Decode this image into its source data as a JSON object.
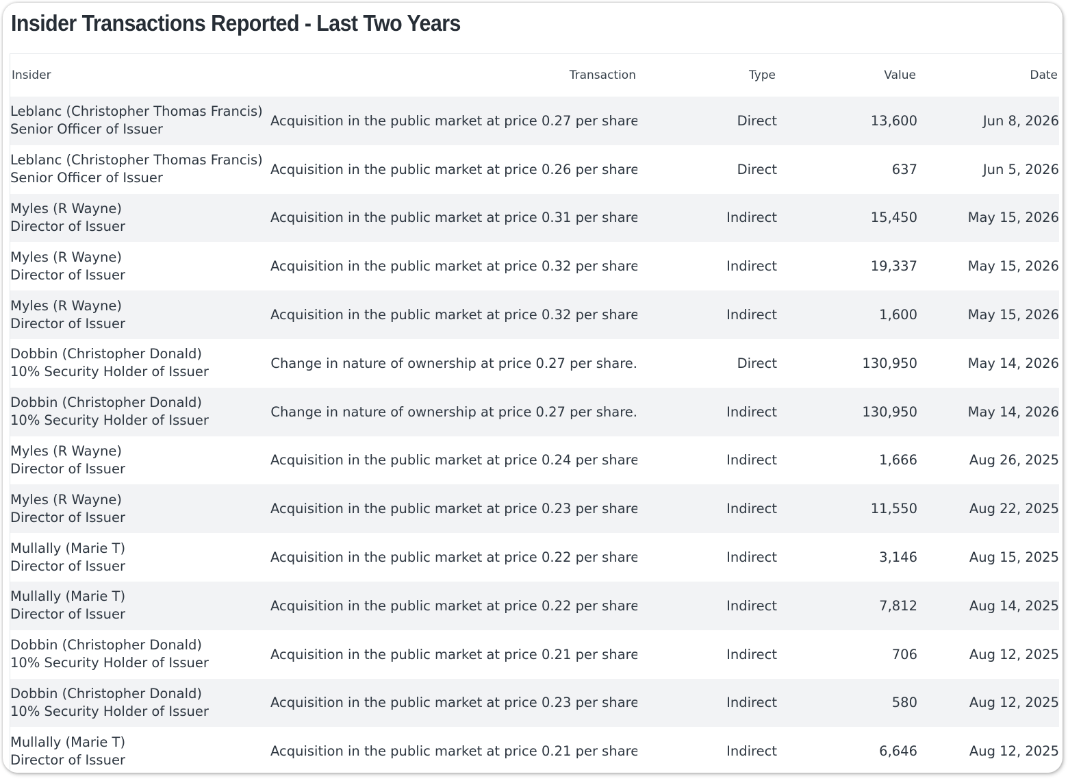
{
  "title": "Insider Transactions Reported - Last Two Years",
  "columns": {
    "insider": "Insider",
    "transaction": "Transaction",
    "type": "Type",
    "value": "Value",
    "date": "Date"
  },
  "rows": [
    {
      "name": "Leblanc (Christopher Thomas Francis)",
      "role": "Senior Officer of Issuer",
      "transaction": "Acquisition in the public market at price 0.27 per share.",
      "type": "Direct",
      "value": "13,600",
      "date": "Jun 8, 2026"
    },
    {
      "name": "Leblanc (Christopher Thomas Francis)",
      "role": "Senior Officer of Issuer",
      "transaction": "Acquisition in the public market at price 0.26 per share.",
      "type": "Direct",
      "value": "637",
      "date": "Jun 5, 2026"
    },
    {
      "name": "Myles (R Wayne)",
      "role": "Director of Issuer",
      "transaction": "Acquisition in the public market at price 0.31 per share.",
      "type": "Indirect",
      "value": "15,450",
      "date": "May 15, 2026"
    },
    {
      "name": "Myles (R Wayne)",
      "role": "Director of Issuer",
      "transaction": "Acquisition in the public market at price 0.32 per share.",
      "type": "Indirect",
      "value": "19,337",
      "date": "May 15, 2026"
    },
    {
      "name": "Myles (R Wayne)",
      "role": "Director of Issuer",
      "transaction": "Acquisition in the public market at price 0.32 per share.",
      "type": "Indirect",
      "value": "1,600",
      "date": "May 15, 2026"
    },
    {
      "name": "Dobbin (Christopher Donald)",
      "role": "10% Security Holder of Issuer",
      "transaction": "Change in nature of ownership at price 0.27 per share.",
      "type": "Direct",
      "value": "130,950",
      "date": "May 14, 2026"
    },
    {
      "name": "Dobbin (Christopher Donald)",
      "role": "10% Security Holder of Issuer",
      "transaction": "Change in nature of ownership at price 0.27 per share.",
      "type": "Indirect",
      "value": "130,950",
      "date": "May 14, 2026"
    },
    {
      "name": "Myles (R Wayne)",
      "role": "Director of Issuer",
      "transaction": "Acquisition in the public market at price 0.24 per share.",
      "type": "Indirect",
      "value": "1,666",
      "date": "Aug 26, 2025"
    },
    {
      "name": "Myles (R Wayne)",
      "role": "Director of Issuer",
      "transaction": "Acquisition in the public market at price 0.23 per share.",
      "type": "Indirect",
      "value": "11,550",
      "date": "Aug 22, 2025"
    },
    {
      "name": "Mullally (Marie T)",
      "role": "Director of Issuer",
      "transaction": "Acquisition in the public market at price 0.22 per share.",
      "type": "Indirect",
      "value": "3,146",
      "date": "Aug 15, 2025"
    },
    {
      "name": "Mullally (Marie T)",
      "role": "Director of Issuer",
      "transaction": "Acquisition in the public market at price 0.22 per share.",
      "type": "Indirect",
      "value": "7,812",
      "date": "Aug 14, 2025"
    },
    {
      "name": "Dobbin (Christopher Donald)",
      "role": "10% Security Holder of Issuer",
      "transaction": "Acquisition in the public market at price 0.21 per share.",
      "type": "Indirect",
      "value": "706",
      "date": "Aug 12, 2025"
    },
    {
      "name": "Dobbin (Christopher Donald)",
      "role": "10% Security Holder of Issuer",
      "transaction": "Acquisition in the public market at price 0.23 per share.",
      "type": "Indirect",
      "value": "580",
      "date": "Aug 12, 2025"
    },
    {
      "name": "Mullally (Marie T)",
      "role": "Director of Issuer",
      "transaction": "Acquisition in the public market at price 0.21 per share.",
      "type": "Indirect",
      "value": "6,646",
      "date": "Aug 12, 2025"
    }
  ]
}
